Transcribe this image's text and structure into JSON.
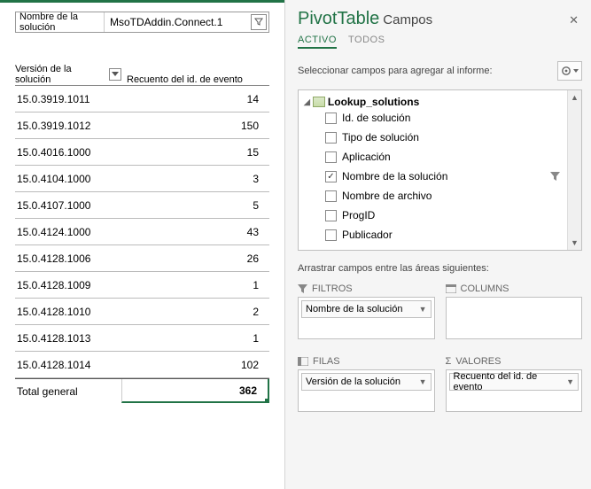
{
  "filter": {
    "label": "Nombre de la solución",
    "value": "MsoTDAddin.Connect.1"
  },
  "headers": {
    "version": "Versión de la solución",
    "count": "Recuento del id. de evento"
  },
  "rows": [
    {
      "v": "15.0.3919.1011",
      "c": "14"
    },
    {
      "v": "15.0.3919.1012",
      "c": "150"
    },
    {
      "v": "15.0.4016.1000",
      "c": "15"
    },
    {
      "v": "15.0.4104.1000",
      "c": "3"
    },
    {
      "v": "15.0.4107.1000",
      "c": "5"
    },
    {
      "v": "15.0.4124.1000",
      "c": "43"
    },
    {
      "v": "15.0.4128.1006",
      "c": "26"
    },
    {
      "v": "15.0.4128.1009",
      "c": "1"
    },
    {
      "v": "15.0.4128.1010",
      "c": "2"
    },
    {
      "v": "15.0.4128.1013",
      "c": "1"
    },
    {
      "v": "15.0.4128.1014",
      "c": "102"
    }
  ],
  "total": {
    "label": "Total general",
    "value": "362"
  },
  "pane": {
    "title": "PivotTable",
    "subtitle": "Campos",
    "tab_active": "ACTIVO",
    "tab_all": "TODOS",
    "select_text": "Seleccionar campos para agregar al informe:",
    "table_name": "Lookup_solutions",
    "fields": {
      "f0": "Id. de solución",
      "f1": "Tipo de solución",
      "f2": "Aplicación",
      "f3": "Nombre de la solución",
      "f4": "Nombre de archivo",
      "f5": "ProgID",
      "f6": "Publicador"
    },
    "drag_text": "Arrastrar campos entre las áreas siguientes:",
    "area_filters": "FILTROS",
    "area_columns": "COLUMNS",
    "area_rows": "FILAS",
    "area_values": "VALORES",
    "sigma": "Σ",
    "pill_filter": "Nombre de la solución",
    "pill_row": "Versión de la solución",
    "pill_value": "Recuento del id. de evento"
  },
  "chart_data": {
    "type": "table",
    "title": "Recuento del id. de evento por Versión de la solución",
    "filter": {
      "field": "Nombre de la solución",
      "value": "MsoTDAddin.Connect.1"
    },
    "columns": [
      "Versión de la solución",
      "Recuento del id. de evento"
    ],
    "rows": [
      [
        "15.0.3919.1011",
        14
      ],
      [
        "15.0.3919.1012",
        150
      ],
      [
        "15.0.4016.1000",
        15
      ],
      [
        "15.0.4104.1000",
        3
      ],
      [
        "15.0.4107.1000",
        5
      ],
      [
        "15.0.4124.1000",
        43
      ],
      [
        "15.0.4128.1006",
        26
      ],
      [
        "15.0.4128.1009",
        1
      ],
      [
        "15.0.4128.1010",
        2
      ],
      [
        "15.0.4128.1013",
        1
      ],
      [
        "15.0.4128.1014",
        102
      ]
    ],
    "total": 362
  }
}
